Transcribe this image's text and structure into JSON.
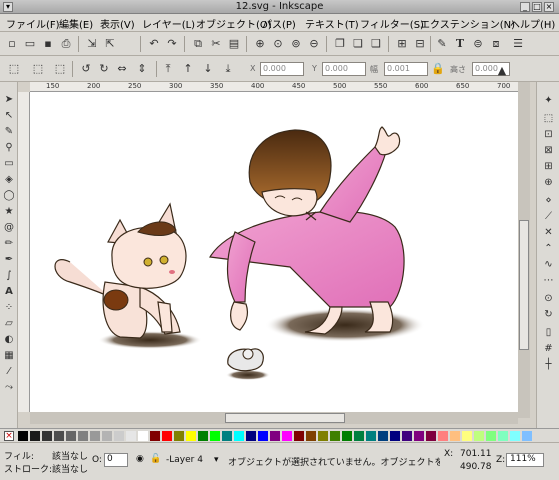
{
  "window": {
    "title": "12.svg - Inkscape"
  },
  "menu": [
    "ファイル(F)",
    "編集(E)",
    "表示(V)",
    "レイヤー(L)",
    "オブジェクト(O)",
    "パス(P)",
    "テキスト(T)",
    "フィルター(S)",
    "エクステンション(N)",
    "ヘルプ(H)"
  ],
  "toolbar": {
    "x_label": "X",
    "x_value": "0.000",
    "y_label": "Y",
    "y_value": "0.000",
    "w_label": "幅",
    "w_value": "0.001",
    "h_label": "高さ",
    "h_value": "0.000"
  },
  "ruler": {
    "ticks": [
      "150",
      "200",
      "250",
      "300",
      "350",
      "400",
      "450",
      "500",
      "550",
      "600",
      "650",
      "700"
    ]
  },
  "palette": {
    "colors": [
      "#000000",
      "#1a1a1a",
      "#333333",
      "#4d4d4d",
      "#666666",
      "#808080",
      "#999999",
      "#b3b3b3",
      "#cccccc",
      "#e6e6e6",
      "#ffffff",
      "#800000",
      "#ff0000",
      "#808000",
      "#ffff00",
      "#008000",
      "#00ff00",
      "#008080",
      "#00ffff",
      "#000080",
      "#0000ff",
      "#800080",
      "#ff00ff",
      "#7f0000",
      "#7f3f00",
      "#7f7f00",
      "#3f7f00",
      "#007f00",
      "#007f3f",
      "#007f7f",
      "#003f7f",
      "#00007f",
      "#3f007f",
      "#7f007f",
      "#7f003f",
      "#ff7f7f",
      "#ffbf7f",
      "#ffff7f",
      "#bfff7f",
      "#7fff7f",
      "#7fffbf",
      "#7fffff",
      "#7fbfff"
    ]
  },
  "status": {
    "fill_label": "フィル:",
    "fill_value": "該当なし",
    "stroke_label": "ストローク:",
    "stroke_value": "該当なし",
    "opacity_label": "O:",
    "opacity_value": "0",
    "layer": "-Layer 4",
    "message": "オブジェクトが選択されていません。オブジェクトをクリ",
    "x_label": "X:",
    "x_coord": "701.11",
    "y_coord": "490.78",
    "zoom_label": "Z:",
    "zoom": "111%"
  }
}
